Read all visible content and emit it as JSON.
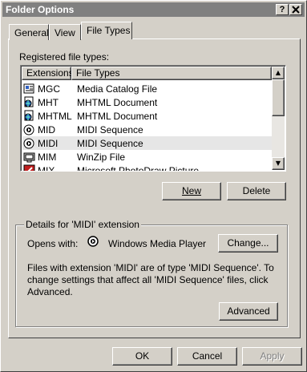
{
  "window": {
    "title": "Folder Options",
    "help_btn": "?",
    "close_btn": "X"
  },
  "tabs": [
    {
      "label": "General",
      "active": false
    },
    {
      "label": "View",
      "active": false
    },
    {
      "label": "File Types",
      "active": true
    }
  ],
  "registered": {
    "label": "Registered file types:",
    "columns": [
      "Extensions",
      "File Types"
    ],
    "rows": [
      {
        "ext": "MGC",
        "type": "Media Catalog File",
        "icon": "media-catalog-icon",
        "selected": false
      },
      {
        "ext": "MHT",
        "type": "MHTML Document",
        "icon": "mhtml-doc-icon",
        "selected": false
      },
      {
        "ext": "MHTML",
        "type": "MHTML Document",
        "icon": "mhtml-doc-icon",
        "selected": false
      },
      {
        "ext": "MID",
        "type": "MIDI Sequence",
        "icon": "media-player-icon",
        "selected": false
      },
      {
        "ext": "MIDI",
        "type": "MIDI Sequence",
        "icon": "media-player-icon",
        "selected": true
      },
      {
        "ext": "MIM",
        "type": "WinZip File",
        "icon": "winzip-icon",
        "selected": false
      },
      {
        "ext": "MIX",
        "type": "Microsoft PhotoDraw Picture",
        "icon": "photodraw-icon",
        "selected": false
      }
    ]
  },
  "buttons": {
    "new": "New",
    "delete": "Delete",
    "change": "Change...",
    "advanced": "Advanced",
    "ok": "OK",
    "cancel": "Cancel",
    "apply": "Apply"
  },
  "details": {
    "group_label": "Details for 'MIDI' extension",
    "opens_with_label": "Opens with:",
    "opens_with_app": "Windows Media Player",
    "description": "Files with extension 'MIDI' are of type 'MIDI Sequence'.  To change settings that affect all 'MIDI Sequence' files, click Advanced."
  },
  "colors": {
    "face": "#d4d0c8",
    "title_inactive": "#808080",
    "selection": "#e6e6e6"
  }
}
